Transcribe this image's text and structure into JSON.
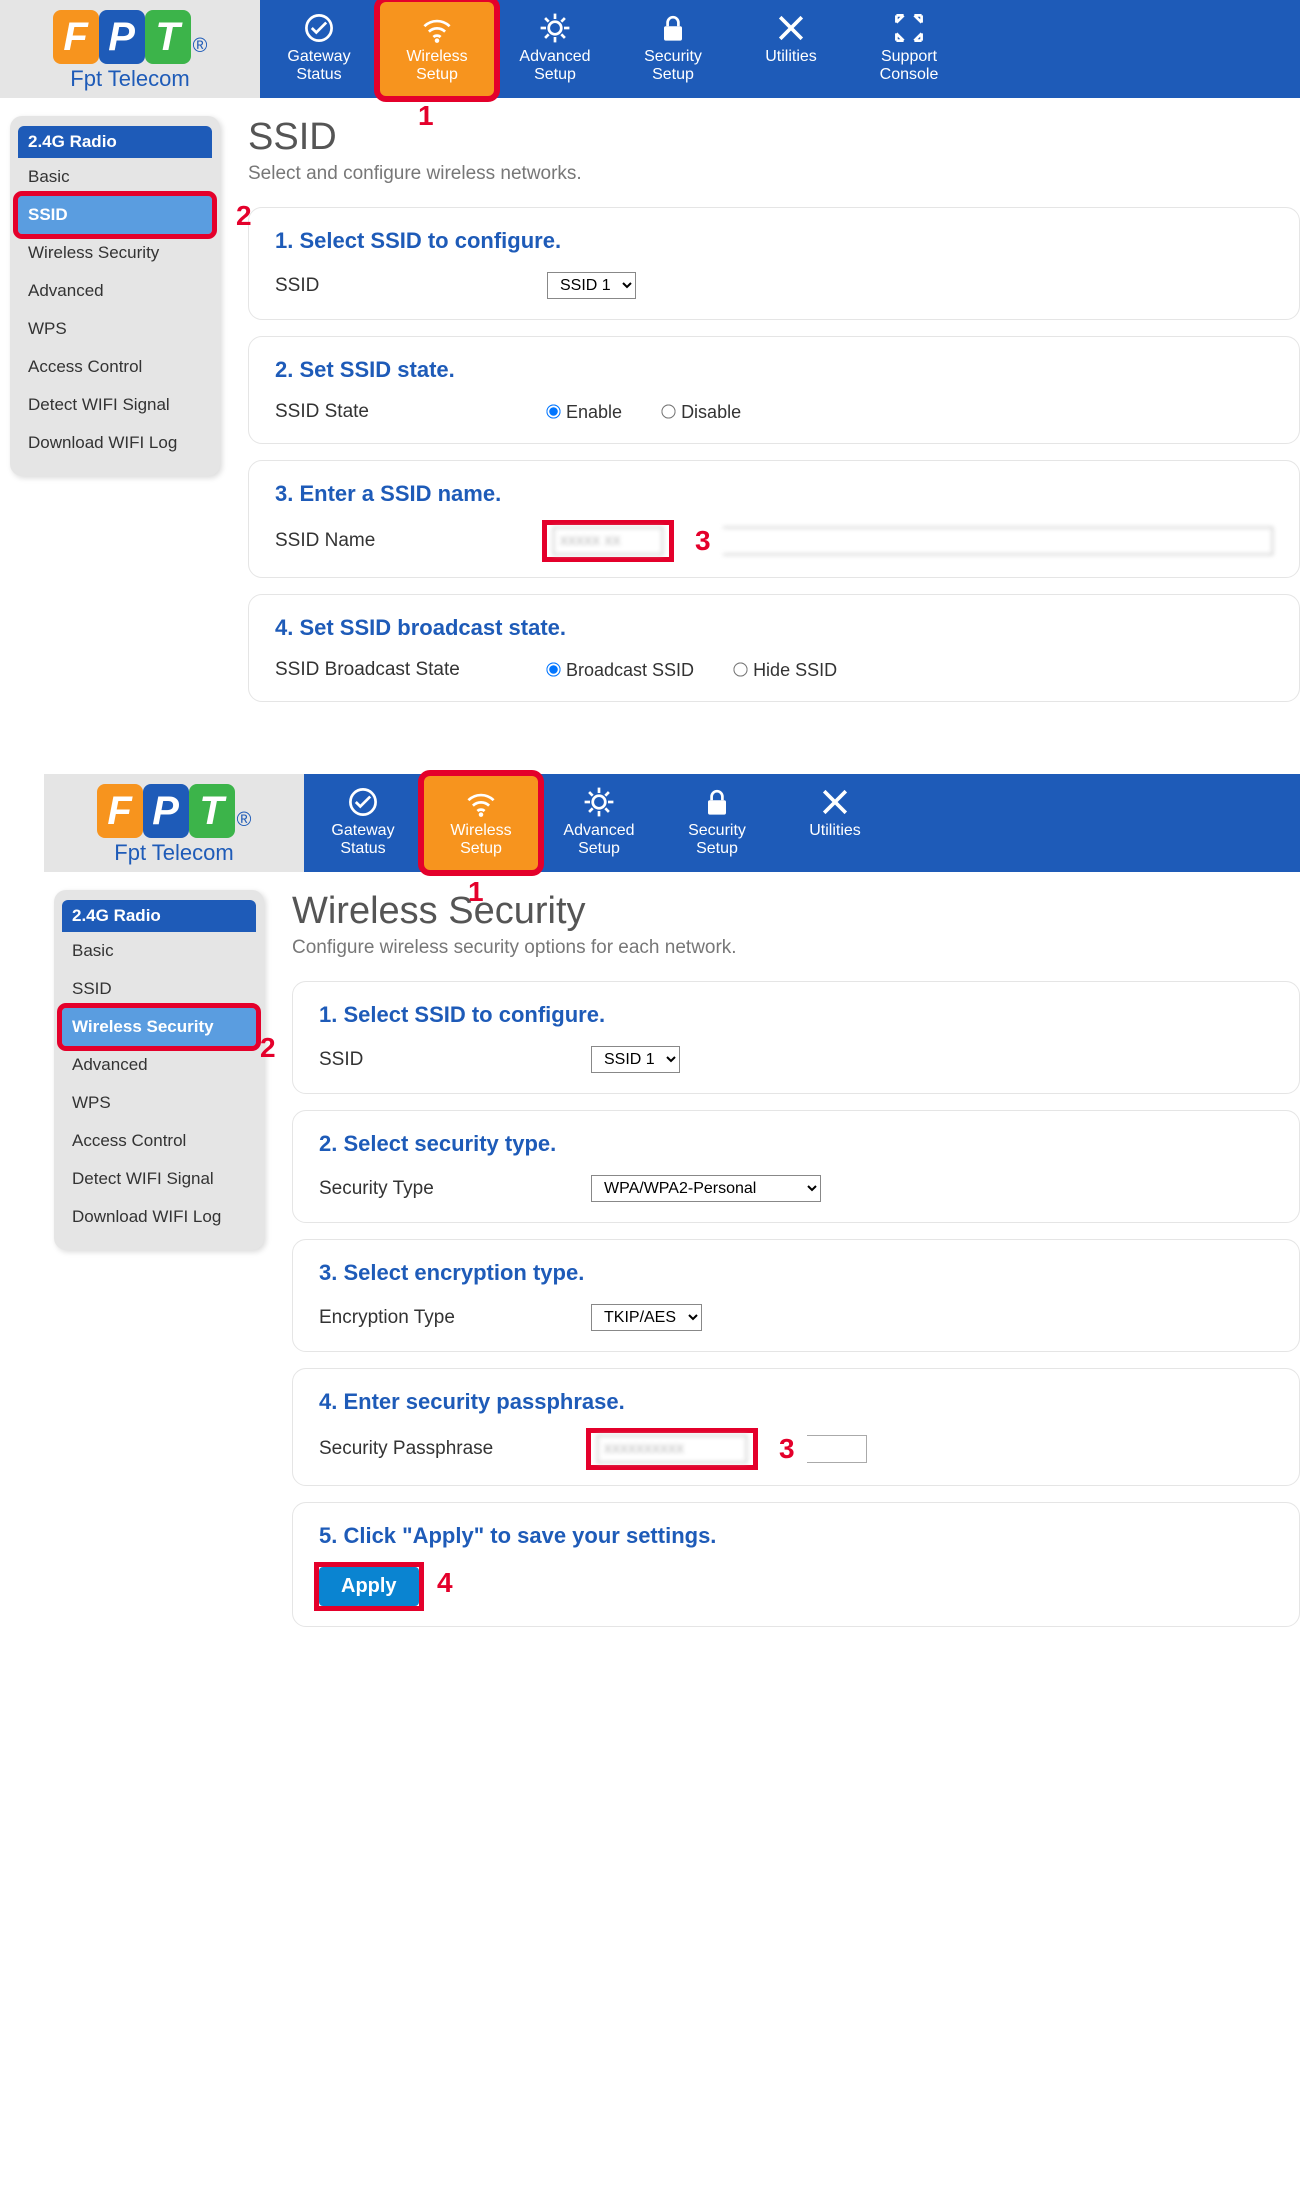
{
  "logo_sub": "Fpt Telecom",
  "topnav": [
    {
      "label": "Gateway\nStatus"
    },
    {
      "label": "Wireless\nSetup"
    },
    {
      "label": "Advanced\nSetup"
    },
    {
      "label": "Security\nSetup"
    },
    {
      "label": "Utilities"
    },
    {
      "label": "Support\nConsole"
    }
  ],
  "sidebar_header": "2.4G Radio",
  "sidebar_items": [
    "Basic",
    "SSID",
    "Wireless Security",
    "Advanced",
    "WPS",
    "Access Control",
    "Detect WIFI Signal",
    "Download WIFI Log"
  ],
  "screen1": {
    "title": "SSID",
    "sub": "Select and configure wireless networks.",
    "p1_h": "1. Select SSID to configure.",
    "p1_label": "SSID",
    "p1_select": "SSID 1",
    "p2_h": "2. Set SSID state.",
    "p2_label": "SSID State",
    "p2_opt1": "Enable",
    "p2_opt2": "Disable",
    "p3_h": "3. Enter a SSID name.",
    "p3_label": "SSID Name",
    "p3_value": "xxxxx xx",
    "p4_h": "4. Set SSID broadcast state.",
    "p4_label": "SSID Broadcast State",
    "p4_opt1": "Broadcast SSID",
    "p4_opt2": "Hide SSID"
  },
  "screen2": {
    "title": "Wireless Security",
    "sub": "Configure wireless security options for each network.",
    "p1_h": "1. Select SSID to configure.",
    "p1_label": "SSID",
    "p1_select": "SSID 1",
    "p2_h": "2. Select security type.",
    "p2_label": "Security Type",
    "p2_select": "WPA/WPA2-Personal",
    "p3_h": "3. Select encryption type.",
    "p3_label": "Encryption Type",
    "p3_select": "TKIP/AES",
    "p4_h": "4. Enter security passphrase.",
    "p4_label": "Security Passphrase",
    "p4_value": "xxxxxxxxxx",
    "p5_h": "5. Click \"Apply\" to save your settings.",
    "apply": "Apply"
  },
  "anno": {
    "n1": "1",
    "n2": "2",
    "n3": "3",
    "n4": "4"
  }
}
